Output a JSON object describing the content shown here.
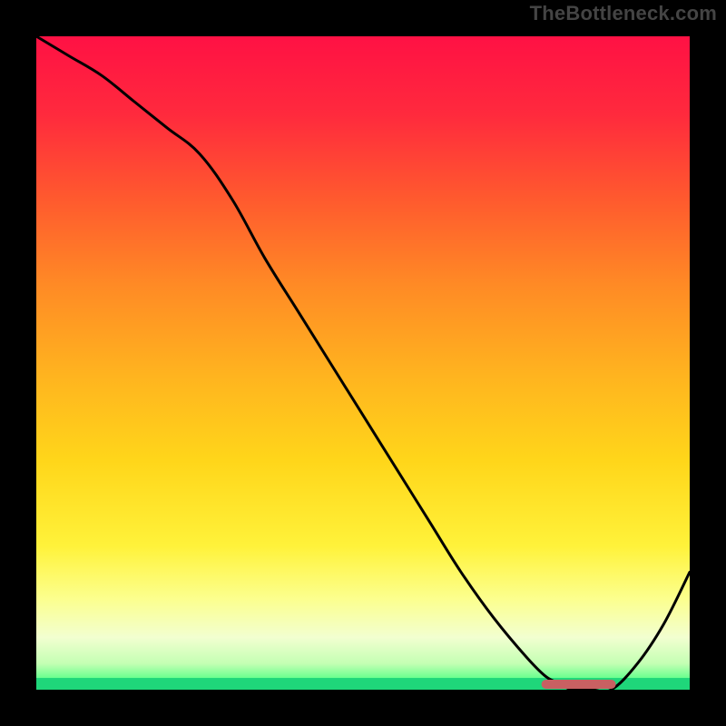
{
  "watermark": "TheBottleneck.com",
  "chart_data": {
    "type": "line",
    "title": "",
    "xlabel": "",
    "ylabel": "",
    "xlim": [
      0,
      100
    ],
    "ylim": [
      0,
      100
    ],
    "x": [
      0,
      5,
      10,
      15,
      20,
      25,
      30,
      35,
      40,
      45,
      50,
      55,
      60,
      65,
      70,
      75,
      78,
      80,
      82,
      85,
      88,
      92,
      96,
      100
    ],
    "values": [
      100,
      97,
      94,
      90,
      86,
      82,
      75,
      66,
      58,
      50,
      42,
      34,
      26,
      18,
      11,
      5,
      2,
      1,
      0,
      0,
      0,
      4,
      10,
      18
    ],
    "marker_segment": {
      "x_start": 78,
      "x_end": 88,
      "y": 0
    },
    "background_gradient": {
      "stops": [
        {
          "offset": 0.0,
          "color": "#ff1144"
        },
        {
          "offset": 0.12,
          "color": "#ff2a3d"
        },
        {
          "offset": 0.25,
          "color": "#ff5a2e"
        },
        {
          "offset": 0.38,
          "color": "#ff8a25"
        },
        {
          "offset": 0.52,
          "color": "#ffb41f"
        },
        {
          "offset": 0.65,
          "color": "#ffd61a"
        },
        {
          "offset": 0.78,
          "color": "#fff23a"
        },
        {
          "offset": 0.86,
          "color": "#fcff8d"
        },
        {
          "offset": 0.92,
          "color": "#f2ffd0"
        },
        {
          "offset": 0.96,
          "color": "#c4ffb3"
        },
        {
          "offset": 0.985,
          "color": "#5eff8a"
        },
        {
          "offset": 1.0,
          "color": "#19e676"
        }
      ]
    },
    "border_px": 40
  }
}
